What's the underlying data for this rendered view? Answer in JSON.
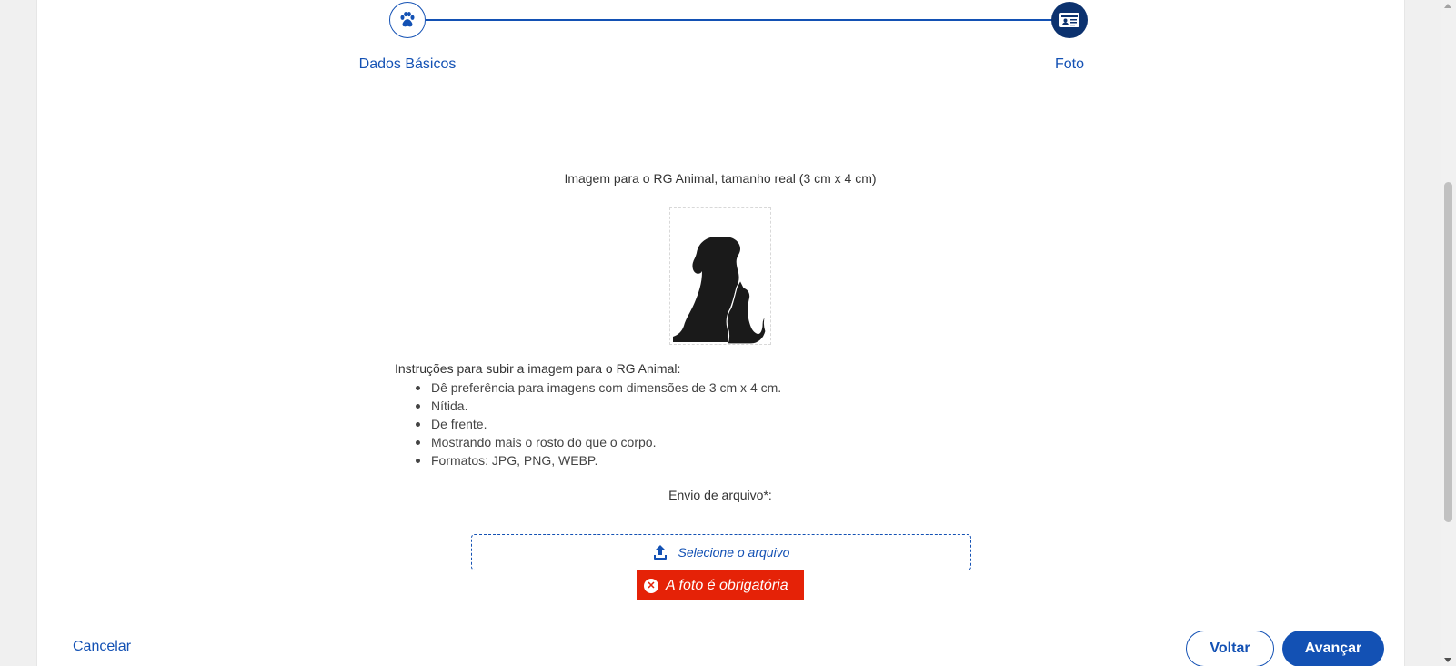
{
  "stepper": {
    "steps": [
      {
        "label": "Dados Básicos",
        "icon": "paw-icon"
      },
      {
        "label": "Foto",
        "icon": "id-card-icon"
      }
    ]
  },
  "photo_section": {
    "title": "Imagem para o RG Animal, tamanho real (3 cm x 4 cm)",
    "placeholder_icon": "dog-and-cat-silhouette"
  },
  "instructions": {
    "title": "Instruções para subir a imagem para o RG Animal:",
    "items": [
      "Dê preferência para imagens com dimensões de 3 cm x 4 cm.",
      "Nítida.",
      "De frente.",
      "Mostrando mais o rosto do que o corpo.",
      "Formatos: JPG, PNG, WEBP."
    ]
  },
  "upload": {
    "label": "Envio de arquivo*:",
    "button_text": "Selecione o arquivo",
    "icon": "upload-icon",
    "error": "A foto é obrigatória"
  },
  "footer": {
    "cancel": "Cancelar",
    "back": "Voltar",
    "next": "Avançar"
  },
  "colors": {
    "primary": "#1351b4",
    "step_active": "#0c326f",
    "error": "#e52207"
  }
}
